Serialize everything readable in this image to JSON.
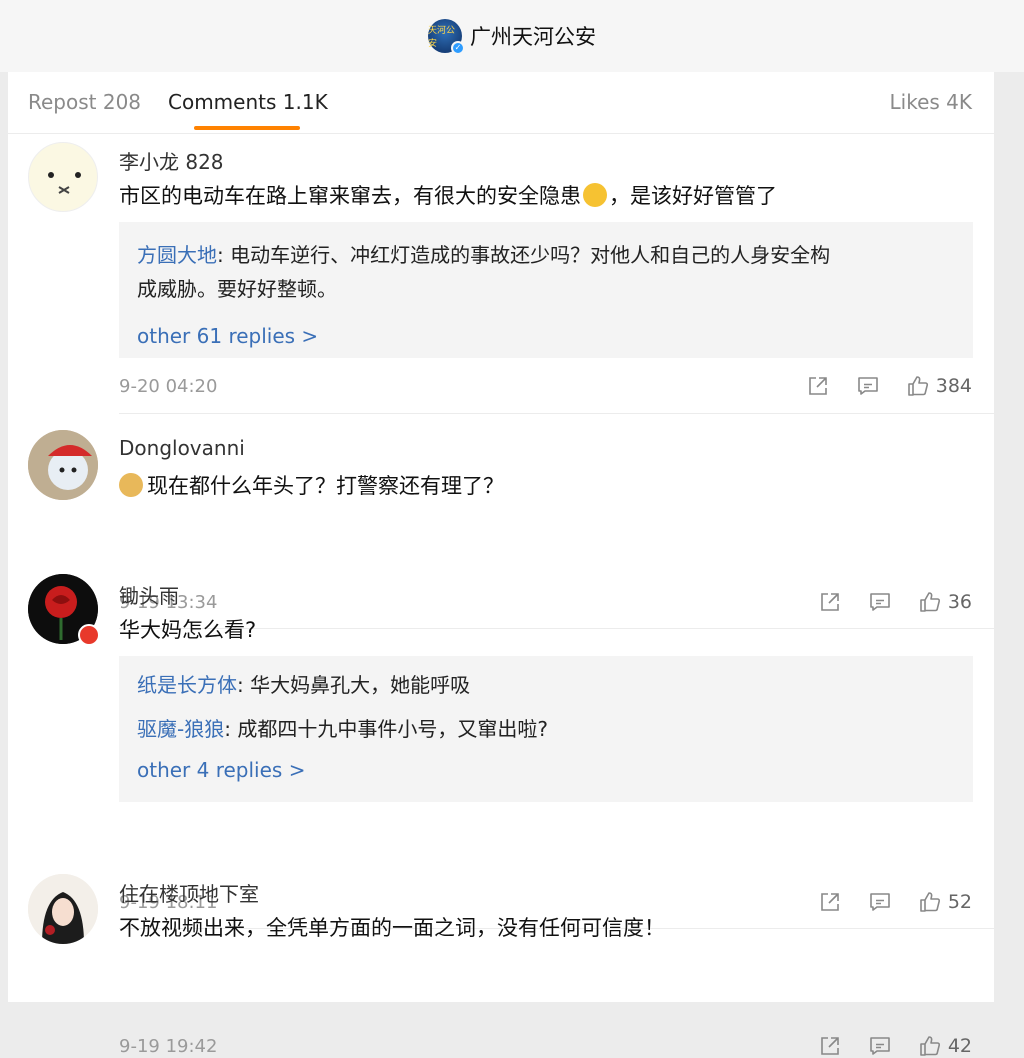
{
  "header": {
    "account_name": "广州天河公安",
    "avatar_text": "天河公安"
  },
  "tabs": {
    "repost": "Repost 208",
    "comments": "Comments 1.1K",
    "likes": "Likes 4K"
  },
  "comments": [
    {
      "author": "李小龙 828",
      "text_before": "市区的电动车在路上窜来窜去，有很大的安全隐患",
      "text_after": "，是该好好管管了",
      "replies": [
        {
          "user": "方圆大地",
          "sep": ": ",
          "text": "电动车逆行、冲红灯造成的事故还少吗？对他人和自己的人身安全构",
          "text2": "成威胁。要好好整顿。"
        }
      ],
      "more": "other 61 replies >",
      "time": "9-20 04:20",
      "likes": "384"
    },
    {
      "author": "Donglovanni",
      "text": "现在都什么年头了？打警察还有理了？",
      "time": "9-19 13:34",
      "likes": "36"
    },
    {
      "author": "锄头雨",
      "text": "华大妈怎么看?",
      "replies": [
        {
          "user": "纸是长方体",
          "sep": ": ",
          "text": "华大妈鼻孔大，她能呼吸"
        },
        {
          "user": "驱魔-狼狼",
          "sep": ": ",
          "text": "成都四十九中事件小号，又窜出啦?"
        }
      ],
      "more": "other 4 replies >",
      "time": "9-19 18:11",
      "likes": "52"
    },
    {
      "author": "住在楼顶地下室",
      "text": "不放视频出来，全凭单方面的一面之词，没有任何可信度！",
      "time": "9-19 19:42",
      "likes": "42"
    }
  ],
  "icons": {
    "share": "share-icon",
    "comment": "comment-icon",
    "like": "thumbs-up-icon"
  },
  "colors": {
    "accent": "#ff8200",
    "link": "#3a6fb7"
  }
}
